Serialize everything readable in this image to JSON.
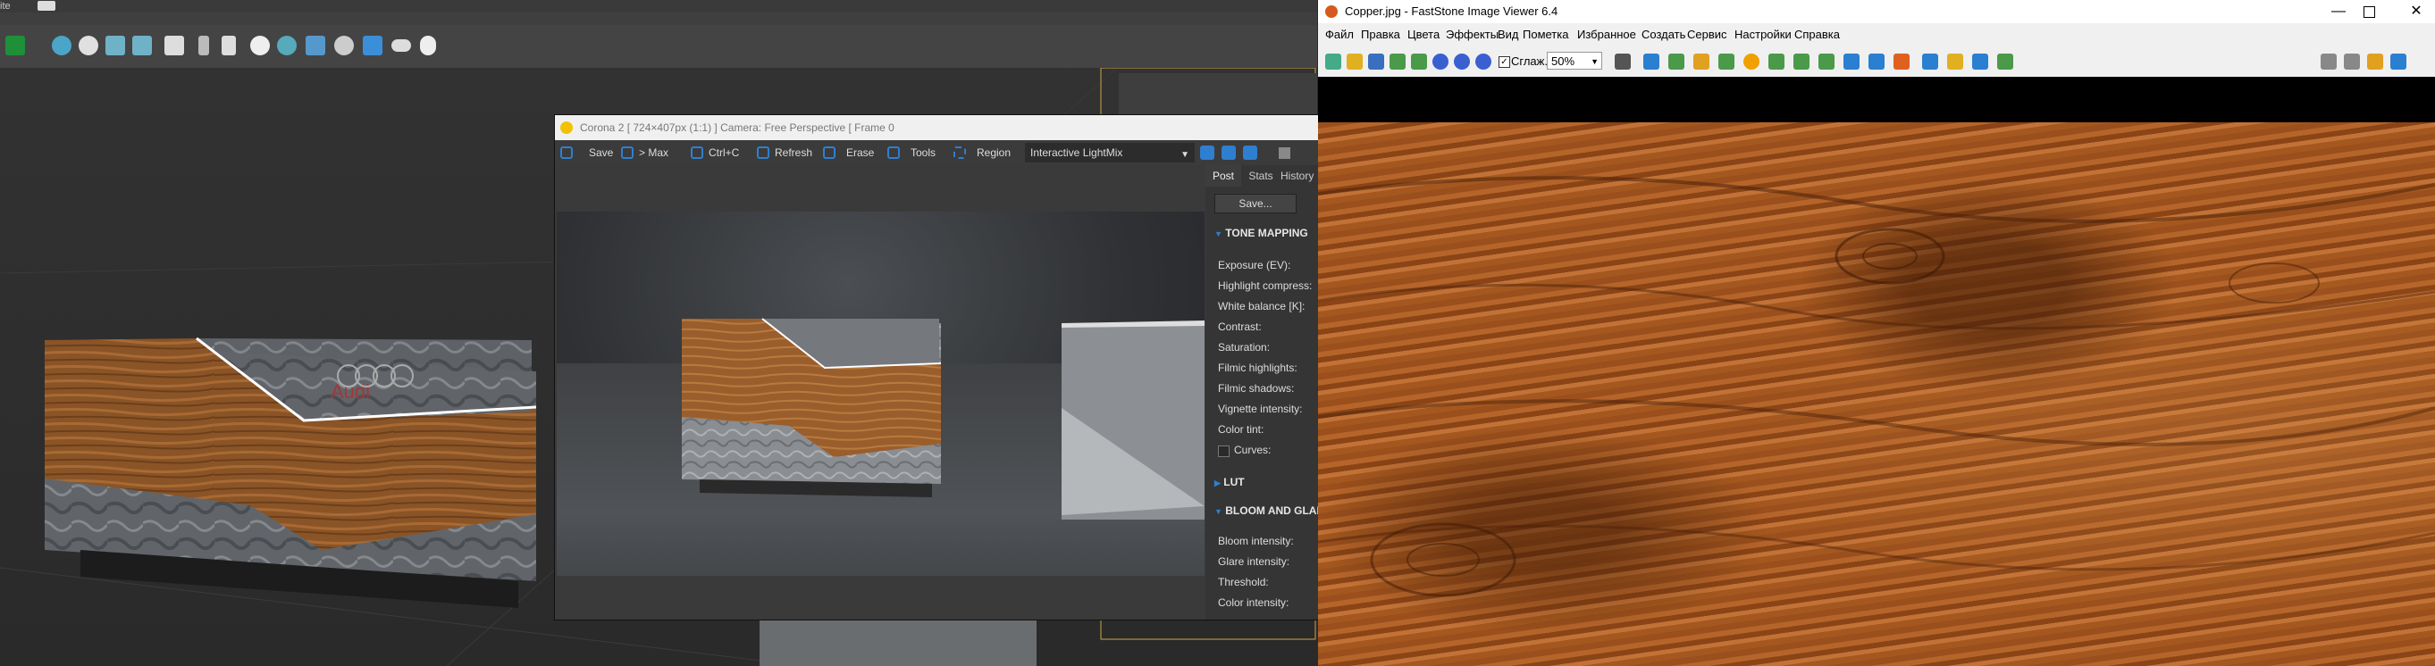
{
  "max": {
    "top_text": "ite"
  },
  "corona": {
    "title": "Corona 2 [ 724×407px (1:1) ] Camera: Free Perspective [ Frame 0",
    "toolbar": {
      "save": "Save",
      "max": "> Max",
      "ctrlc": "Ctrl+C",
      "refresh": "Refresh",
      "erase": "Erase",
      "tools": "Tools",
      "region": "Region",
      "lightmix": "Interactive LightMix"
    },
    "tabs": [
      "Post",
      "Stats",
      "History"
    ],
    "save_btn": "Save...",
    "sections": {
      "tone_mapping": "TONE MAPPING",
      "lut": "LUT",
      "bloom": "BLOOM AND GLARE"
    },
    "tone_params": [
      "Exposure (EV):",
      "Highlight compress:",
      "White balance [K]:",
      "Contrast:",
      "Saturation:",
      "Filmic highlights:",
      "Filmic shadows:",
      "Vignette intensity:",
      "Color tint:",
      "Curves:"
    ],
    "bloom_params": [
      "Bloom intensity:",
      "Glare intensity:",
      "Threshold:",
      "Color intensity:"
    ]
  },
  "faststone": {
    "title": "Copper.jpg - FastStone Image Viewer 6.4",
    "menu": [
      "Файл",
      "Правка",
      "Цвета",
      "Эффекты",
      "Вид",
      "Пометка",
      "Избранное",
      "Создать",
      "Сервис",
      "Настройки",
      "Справка"
    ],
    "smooth_label": "Сглаж.",
    "zoom": "50%"
  },
  "colors": {
    "corona_accent": "#2f7fd0",
    "max_bg": "#2d2d2d",
    "fs_bg": "#f0f0f0"
  }
}
